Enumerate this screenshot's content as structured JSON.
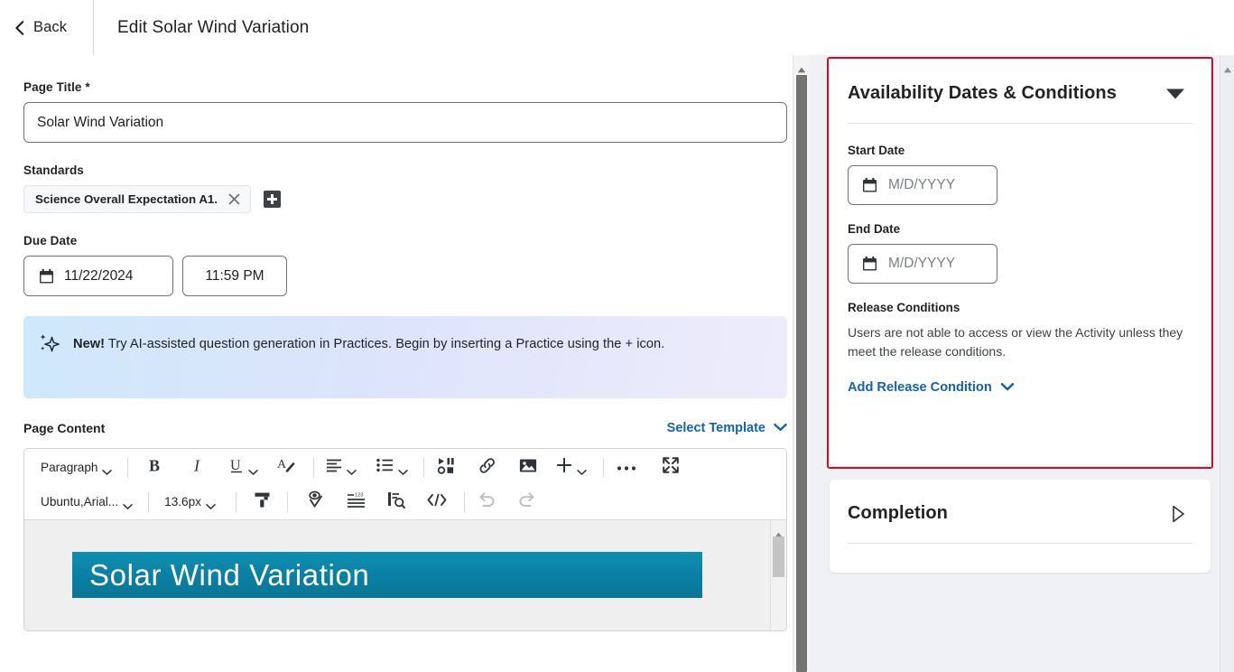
{
  "header": {
    "back_label": "Back",
    "title": "Edit Solar Wind Variation",
    "back_icon": "chevron-left-icon"
  },
  "form": {
    "page_title_label": "Page Title *",
    "page_title_value": "Solar Wind Variation",
    "page_title_placeholder": "",
    "standards_label": "Standards",
    "standard_chip": "Science Overall Expectation A1.",
    "standard_remove_icon": "close-icon",
    "add_standard_icon": "plus-square-icon",
    "due_date_label": "Due Date",
    "due_date_value": "11/22/2024",
    "due_time_value": "11:59 PM",
    "calendar_icon": "calendar-icon"
  },
  "banner": {
    "icon": "sparkle-ai-icon",
    "lead": "New!",
    "text": " Try AI-assisted question generation in Practices. Begin by inserting a Practice using the + icon."
  },
  "page_content": {
    "label": "Page Content",
    "select_template_label": "Select Template",
    "select_template_icon": "chevron-down-icon"
  },
  "editor": {
    "toolbar_row1": [
      {
        "name": "paragraph-style-select",
        "label": "Paragraph",
        "icon": "chevron-down-icon",
        "type": "select"
      },
      {
        "name": "bold-button",
        "label": "B",
        "icon": "bold-icon",
        "type": "icon"
      },
      {
        "name": "italic-button",
        "label": "I",
        "icon": "italic-icon",
        "type": "icon"
      },
      {
        "name": "underline-button",
        "label": "U",
        "icon": "underline-icon",
        "type": "icon-chevron"
      },
      {
        "name": "text-color-button",
        "label": "A",
        "icon": "text-color-icon",
        "type": "icon"
      },
      {
        "name": "align-button",
        "label": "",
        "icon": "align-left-icon",
        "type": "icon-chevron"
      },
      {
        "name": "list-button",
        "label": "",
        "icon": "bullet-list-icon",
        "type": "icon-chevron"
      },
      {
        "name": "insert-media-button",
        "label": "",
        "icon": "media-icon",
        "type": "icon"
      },
      {
        "name": "insert-link-button",
        "label": "",
        "icon": "link-icon",
        "type": "icon"
      },
      {
        "name": "insert-image-button",
        "label": "",
        "icon": "image-icon",
        "type": "icon"
      },
      {
        "name": "insert-stuff-button",
        "label": "",
        "icon": "plus-icon",
        "type": "icon-chevron"
      },
      {
        "name": "more-options-button",
        "label": "",
        "icon": "ellipsis-icon",
        "type": "icon"
      },
      {
        "name": "fullscreen-button",
        "label": "",
        "icon": "expand-icon",
        "type": "icon"
      }
    ],
    "toolbar_row2": [
      {
        "name": "font-family-select",
        "label": "Ubuntu,Arial...",
        "icon": "chevron-down-icon",
        "type": "select"
      },
      {
        "name": "font-size-select",
        "label": "13.6px",
        "icon": "chevron-down-icon",
        "type": "select"
      },
      {
        "name": "format-painter-button",
        "label": "",
        "icon": "format-painter-icon",
        "type": "icon"
      },
      {
        "name": "accessibility-checker-button",
        "label": "",
        "icon": "accessibility-check-icon",
        "type": "icon"
      },
      {
        "name": "word-count-button",
        "label": "",
        "icon": "word-count-icon",
        "type": "icon"
      },
      {
        "name": "preview-button",
        "label": "",
        "icon": "preview-search-icon",
        "type": "icon"
      },
      {
        "name": "source-code-button",
        "label": "",
        "icon": "code-icon",
        "type": "icon"
      },
      {
        "name": "undo-button",
        "label": "",
        "icon": "undo-icon",
        "type": "icon"
      },
      {
        "name": "redo-button",
        "label": "",
        "icon": "redo-icon",
        "type": "icon"
      }
    ],
    "content_heading": "Solar Wind Variation",
    "content_heading_bg": "#0a7fa3",
    "content_heading_color": "#ffffff"
  },
  "availability": {
    "title": "Availability Dates & Conditions",
    "collapse_icon": "triangle-down-icon",
    "start_date_label": "Start Date",
    "start_date_placeholder": "M/D/YYYY",
    "end_date_label": "End Date",
    "end_date_placeholder": "M/D/YYYY",
    "release_conditions_label": "Release Conditions",
    "release_conditions_desc": "Users are not able to access or view the Activity unless they meet the release conditions.",
    "add_release_condition_label": "Add Release Condition",
    "add_release_condition_icon": "chevron-down-icon",
    "calendar_icon": "calendar-icon",
    "highlight_color": "#c8102e"
  },
  "completion": {
    "title": "Completion",
    "expand_icon": "triangle-right-icon"
  },
  "colors": {
    "link": "#1362ad",
    "accent_teal": "#0a7fa3",
    "highlight": "#c8102e",
    "panel_bg": "#eff1f5"
  }
}
